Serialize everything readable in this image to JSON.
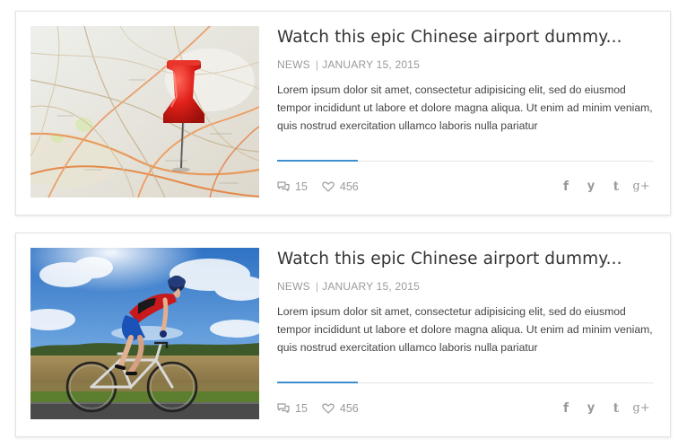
{
  "posts": [
    {
      "title": "Watch this epic Chinese airport dummy...",
      "category": "NEWS",
      "separator": "|",
      "date": "JANUARY 15, 2015",
      "excerpt": "Lorem ipsum dolor sit amet, consectetur adipisicing elit, sed do eiusmod tempor incididunt ut labore et dolore magna aliqua. Ut enim ad minim veniam, quis nostrud exercitation ullamco laboris nulla pariatur",
      "comments": "15",
      "likes": "456",
      "image": "map-pushpin-photo"
    },
    {
      "title": "Watch this epic Chinese airport dummy...",
      "category": "NEWS",
      "separator": "|",
      "date": "JANUARY 15, 2015",
      "excerpt": "Lorem ipsum dolor sit amet, consectetur adipisicing elit, sed do eiusmod tempor incididunt ut labore et dolore magna aliqua. Ut enim ad minim veniam, quis nostrud exercitation ullamco laboris nulla pariatur",
      "comments": "15",
      "likes": "456",
      "image": "cyclist-photo"
    }
  ],
  "social": {
    "facebook": "f",
    "twitter": "y",
    "tumblr": "t",
    "google_plus": "g+"
  },
  "icons": {
    "comments": "comments-icon",
    "likes": "heart-icon"
  },
  "colors": {
    "accent": "#3e8ed0",
    "title": "#333333",
    "meta": "#9a9a9a",
    "text": "#444444"
  }
}
